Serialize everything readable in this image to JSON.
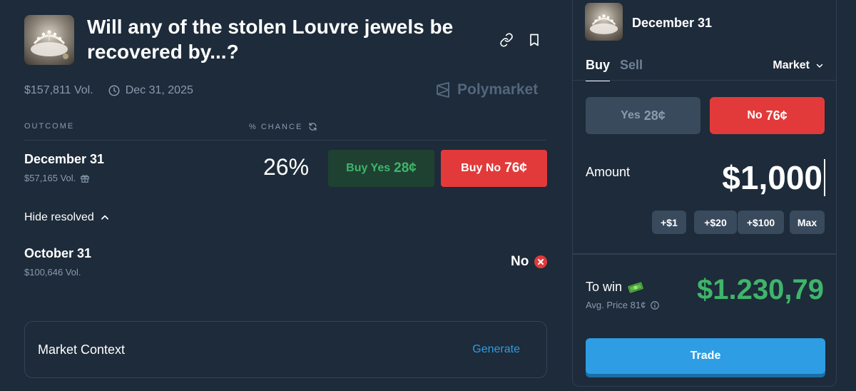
{
  "market": {
    "title": "Will any of the stolen Louvre jewels be recovered by...?",
    "volume": "$157,811 Vol.",
    "end_date": "Dec 31, 2025",
    "brand": "Polymarket"
  },
  "table": {
    "col_outcome": "OUTCOME",
    "col_chance": "% CHANCE"
  },
  "outcomes": [
    {
      "name": "December 31",
      "volume": "$57,165 Vol.",
      "chance": "26%",
      "buy_yes_label": "Buy Yes",
      "buy_yes_price": "28¢",
      "buy_no_label": "Buy No",
      "buy_no_price": "76¢"
    }
  ],
  "hide_resolved_label": "Hide resolved",
  "resolved": [
    {
      "name": "October 31",
      "volume": "$100,646 Vol.",
      "result": "No"
    }
  ],
  "context": {
    "label": "Market Context",
    "action": "Generate"
  },
  "panel": {
    "title": "December 31",
    "tab_buy": "Buy",
    "tab_sell": "Sell",
    "order_type": "Market",
    "yes_label": "Yes",
    "yes_price": "28¢",
    "no_label": "No",
    "no_price": "76¢",
    "amount_label": "Amount",
    "amount_value": "$1,000",
    "quick_amounts": [
      "+$1",
      "+$20",
      "+$100",
      "Max"
    ],
    "to_win_label": "To win",
    "avg_price": "Avg. Price 81¢",
    "payout": "$1.230,79",
    "trade_label": "Trade"
  },
  "colors": {
    "background": "#1d2b3a",
    "green": "#3fb56a",
    "red": "#e23a3a",
    "blue": "#2f9de3",
    "muted": "#8a9bb0"
  },
  "icons": [
    "link-icon",
    "bookmark-icon",
    "clock-icon",
    "polymarket-logo-icon",
    "refresh-icon",
    "gift-icon",
    "chevron-up-icon",
    "close-circle-icon",
    "chevron-down-icon",
    "money-icon",
    "info-icon"
  ]
}
